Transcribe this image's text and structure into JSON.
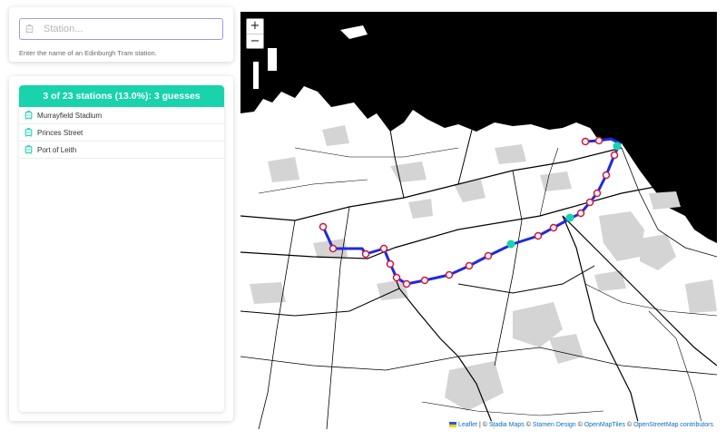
{
  "search": {
    "placeholder": "Station...",
    "value": "",
    "hint": "Enter the name of an Edinburgh Tram station."
  },
  "results": {
    "summary": "3 of 23 stations (13.0%): 3 guesses",
    "stations": [
      {
        "name": "Murrayfield Stadium"
      },
      {
        "name": "Princes Street"
      },
      {
        "name": "Port of Leith"
      }
    ]
  },
  "map": {
    "zoom_in": "+",
    "zoom_out": "−",
    "attribution": {
      "leaflet": "Leaflet",
      "sep1": " | © ",
      "stadia": "Stadia Maps",
      "sep2": " © ",
      "stamen": "Stamen Design",
      "sep3": " © ",
      "omt": "OpenMapTiles",
      "sep4": " © ",
      "osm": "OpenStreetMap contributors"
    },
    "colors": {
      "tram_line": "#1f2bdc",
      "station_unguessed": "#d6113a",
      "station_guessed": "#19d3ad",
      "sea": "#000000",
      "land": "#ffffff",
      "parks": "#d4d4d4"
    }
  }
}
